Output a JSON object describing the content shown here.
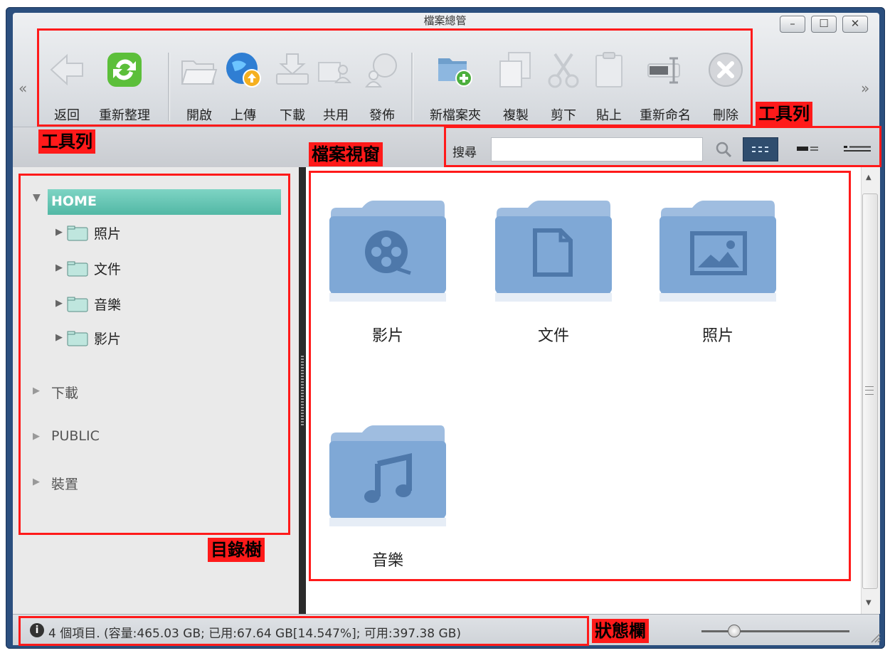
{
  "window": {
    "title": "檔案總管",
    "controls": [
      "minimize-icon",
      "maximize-icon",
      "close-icon"
    ],
    "minimize_glyph": "–",
    "maximize_glyph": "☐",
    "close_glyph": "✕"
  },
  "toolbar": {
    "scroll_left": "«",
    "scroll_right": "»",
    "buttons": [
      {
        "label": "返回",
        "icon": "back-arrow-icon"
      },
      {
        "label": "重新整理",
        "icon": "refresh-icon"
      },
      {
        "label": "開啟",
        "icon": "open-folder-icon"
      },
      {
        "label": "上傳",
        "icon": "upload-globe-icon"
      },
      {
        "label": "下載",
        "icon": "download-icon"
      },
      {
        "label": "共用",
        "icon": "share-icon"
      },
      {
        "label": "發佈",
        "icon": "publish-icon"
      },
      {
        "label": "新檔案夾",
        "icon": "new-folder-icon"
      },
      {
        "label": "複製",
        "icon": "copy-icon"
      },
      {
        "label": "剪下",
        "icon": "cut-scissors-icon"
      },
      {
        "label": "貼上",
        "icon": "paste-clipboard-icon"
      },
      {
        "label": "重新命名",
        "icon": "rename-icon"
      },
      {
        "label": "刪除",
        "icon": "delete-icon"
      }
    ]
  },
  "search": {
    "label": "搜尋",
    "value": "",
    "placeholder": ""
  },
  "views": [
    "grid-view-icon",
    "list-view-icon",
    "detail-view-icon"
  ],
  "tree": {
    "root": "HOME",
    "children": [
      "照片",
      "文件",
      "音樂",
      "影片"
    ],
    "other_roots": [
      "下載",
      "PUBLIC",
      "裝置"
    ]
  },
  "files": [
    {
      "label": "影片",
      "icon": "film-reel-icon"
    },
    {
      "label": "文件",
      "icon": "document-icon"
    },
    {
      "label": "照片",
      "icon": "picture-icon"
    },
    {
      "label": "音樂",
      "icon": "music-note-icon"
    }
  ],
  "status": {
    "text": "4 個項目. (容量:465.03 GB; 已用:67.64 GB[14.547%]; 可用:397.38 GB)",
    "zoom_fraction": 0.22
  },
  "annotations": {
    "toolbar_top": "工具列",
    "toolbar_bottom": "工具列",
    "file_view": "檔案視窗",
    "directory_tree": "目錄樹",
    "status_bar": "狀態欄"
  },
  "colors": {
    "annotation": "#ff1a1a",
    "frame": "#2b4f7e",
    "selected_tree": "#52b8a5",
    "folder": "#7fa8d6"
  }
}
